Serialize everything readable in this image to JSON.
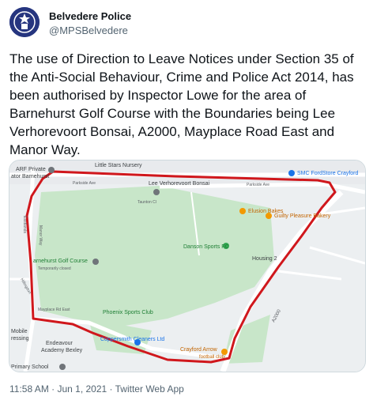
{
  "account": {
    "name": "Belvedere Police",
    "handle": "@MPSBelvedere"
  },
  "tweet": {
    "text": "The use of Direction to Leave Notices under Section 35 of the Anti-Social Behaviour, Crime and Police Act 2014, has been authorised by Inspector Lowe for the area of Barnehurst Golf Course with the Boundaries being Lee Verhorevoort Bonsai, A2000, Mayplace Road East and Manor Way."
  },
  "map": {
    "labels": {
      "arf_private": "ARF Private",
      "arf_private2": "ator Barnehurst",
      "little_stars": "Little Stars Nursery",
      "smc_fordstore": "SMC FordStore Crayford",
      "parkside_ave1": "Parkside Ave",
      "parkside_ave2": "Parkside Ave",
      "lee_verhorevoort": "Lee Verhorevoort Bonsai",
      "elusion_bakes": "Elusion Bakes",
      "guilty_pleasure": "Guilty Pleasure Bakery",
      "danson_sports": "Danson Sports FC",
      "housing": "Housing 2",
      "barnehurst_golf": "arnehurst Golf Course",
      "temp_closed": "Temporarily closed",
      "mayplace_rd": "Mayplace Rd East",
      "phoenix_sports": "Phoenix Sports Club",
      "coppersmith": "Coppersmith Cleaners Ltd",
      "mobile": "Mobile",
      "dressing": "ressing",
      "endeavour": "Endeavour",
      "academy": "Academy Bexley",
      "crayford_arrow": "Crayford Arrow",
      "football_club": "football club",
      "primary_school": "Primary School",
      "a2000": "A2000",
      "taunton_cl": "Taunton Cl",
      "manor_way": "Manor Way",
      "eastlands": "Eastlands",
      "hillingdon": "Hillingdon"
    },
    "colors": {
      "boundary": "#d0171c",
      "park": "#c8e6c9",
      "road": "#ffffff",
      "poi_orange": "#f29900",
      "poi_grey": "#70757a",
      "poi_blue": "#1a73e8"
    }
  },
  "meta": {
    "timestamp": "11:58 AM · Jun 1, 2021 · Twitter Web App"
  }
}
